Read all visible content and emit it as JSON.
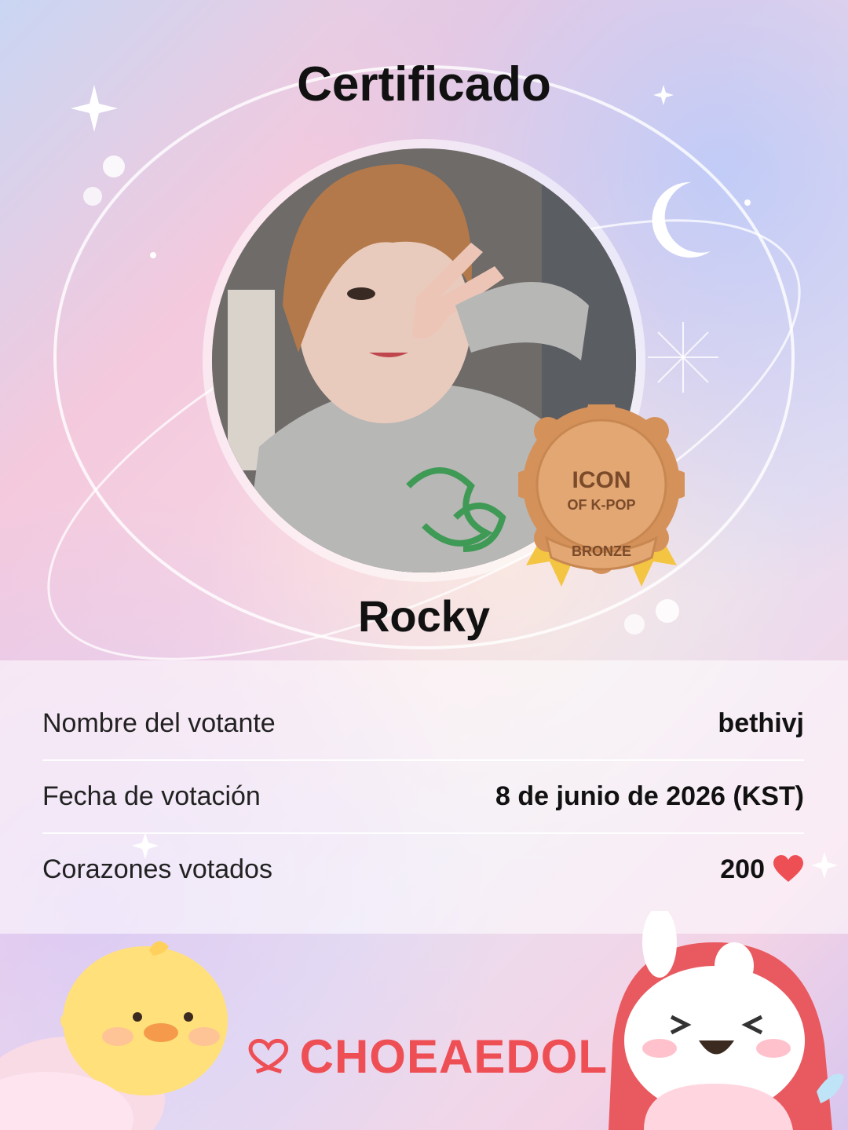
{
  "certificate": {
    "title": "Certificado",
    "idol_name": "Rocky",
    "badge": {
      "line1": "ICON",
      "line2": "OF K-POP",
      "tier": "BRONZE"
    }
  },
  "info": {
    "rows": [
      {
        "label": "Nombre del votante",
        "value": "bethivj"
      },
      {
        "label": "Fecha de votación",
        "value": "8 de junio de 2026 (KST)"
      },
      {
        "label": "Corazones votados",
        "value": "200"
      }
    ],
    "heart_icon": "heart-icon"
  },
  "footer": {
    "logo_text": "CHOEAEDOL"
  },
  "colors": {
    "accent": "#ee4f55",
    "badge_bronze": "#d99a5e",
    "ribbon": "#f4c542"
  }
}
